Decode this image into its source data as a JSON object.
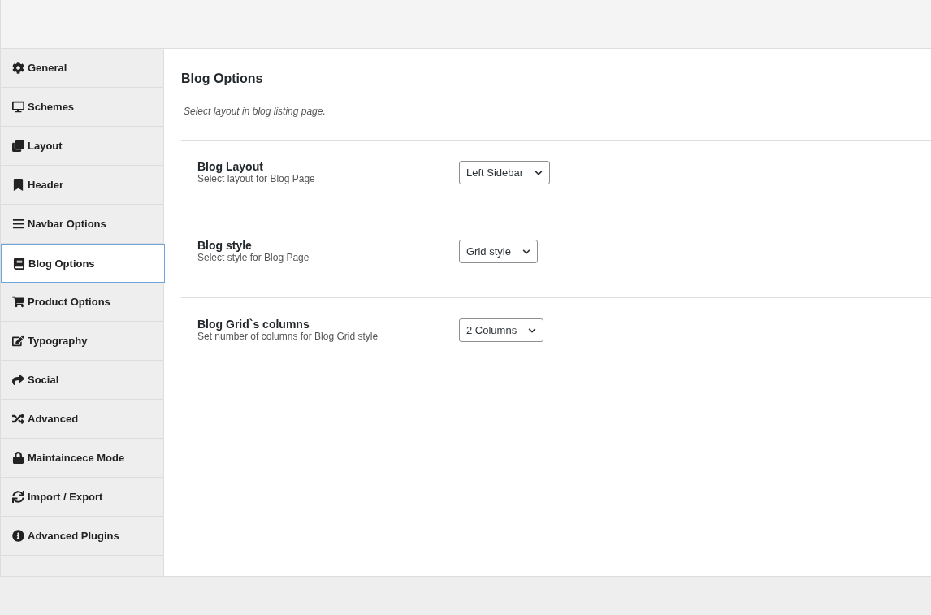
{
  "sidebar": {
    "items": [
      {
        "label": "General",
        "selected": false
      },
      {
        "label": "Schemes",
        "selected": false
      },
      {
        "label": "Layout",
        "selected": false
      },
      {
        "label": "Header",
        "selected": false
      },
      {
        "label": "Navbar Options",
        "selected": false
      },
      {
        "label": "Blog Options",
        "selected": true
      },
      {
        "label": "Product Options",
        "selected": false
      },
      {
        "label": "Typography",
        "selected": false
      },
      {
        "label": "Social",
        "selected": false
      },
      {
        "label": "Advanced",
        "selected": false
      },
      {
        "label": "Maintaincece Mode",
        "selected": false
      },
      {
        "label": "Import / Export",
        "selected": false
      },
      {
        "label": "Advanced Plugins",
        "selected": false
      }
    ]
  },
  "main": {
    "title": "Blog Options",
    "description": "Select layout in blog listing page.",
    "options": [
      {
        "label": "Blog Layout",
        "hint": "Select layout for Blog Page",
        "value": "Left Sidebar"
      },
      {
        "label": "Blog style",
        "hint": "Select style for Blog Page",
        "value": "Grid style"
      },
      {
        "label": "Blog Grid`s columns",
        "hint": "Set number of columns for Blog Grid style",
        "value": "2 Columns"
      }
    ]
  }
}
